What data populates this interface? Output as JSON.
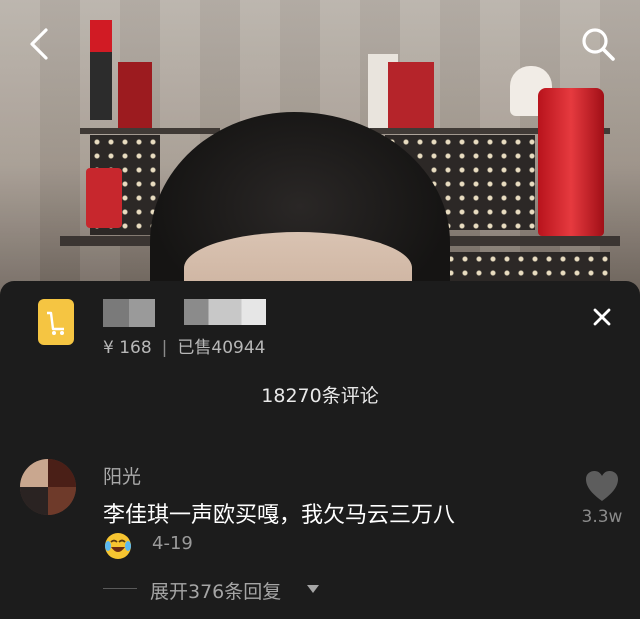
{
  "product": {
    "price": "¥ 168",
    "sold": "已售40944"
  },
  "comments_header": {
    "count_label": "18270条评论"
  },
  "comment": {
    "username": "阳光",
    "text": "李佳琪一声欧买嘎，我欠马云三万八",
    "date": "4-19",
    "likes": "3.3w",
    "emoji_icon": "laughing-crying-emoji"
  },
  "replies": {
    "expand_label": "展开376条回复"
  },
  "icons": {
    "back": "back-arrow-icon",
    "search": "search-icon",
    "close": "close-icon",
    "like": "heart-icon",
    "product": "shopping-cart-icon",
    "caret": "caret-down-icon"
  },
  "colors": {
    "sheet_bg": "#1c1c1c",
    "product_icon_bg": "#f5c542"
  }
}
